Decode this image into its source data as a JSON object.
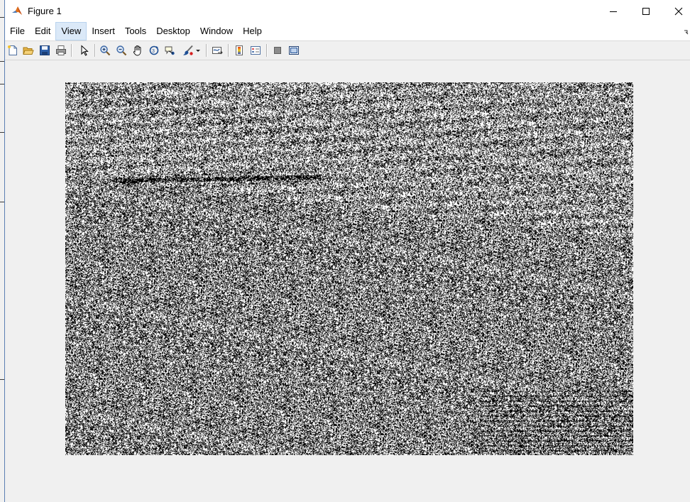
{
  "window": {
    "title": "Figure 1",
    "app_icon": "matlab-icon",
    "controls": [
      "minimize-icon",
      "maximize-icon",
      "close-icon"
    ]
  },
  "menu": {
    "items": [
      {
        "label": "File"
      },
      {
        "label": "Edit"
      },
      {
        "label": "View",
        "active": true
      },
      {
        "label": "Insert"
      },
      {
        "label": "Tools"
      },
      {
        "label": "Desktop"
      },
      {
        "label": "Window"
      },
      {
        "label": "Help"
      }
    ]
  },
  "toolbar": {
    "buttons": [
      "new-figure-icon",
      "open-file-icon",
      "save-figure-icon",
      "print-figure-icon",
      "edit-plot-arrow-icon",
      "zoom-in-icon",
      "zoom-out-icon",
      "pan-hand-icon",
      "rotate-3d-icon",
      "data-cursor-icon",
      "brush-icon",
      "brush-dropdown-icon",
      "link-plot-icon",
      "insert-colorbar-icon",
      "insert-legend-icon",
      "hide-plot-tools-icon",
      "show-plot-tools-icon"
    ]
  },
  "figure": {
    "content": "grayscale-noise-image",
    "colors": {
      "dark": "#000000",
      "light": "#ffffff",
      "background": "#f0f0f0"
    }
  }
}
